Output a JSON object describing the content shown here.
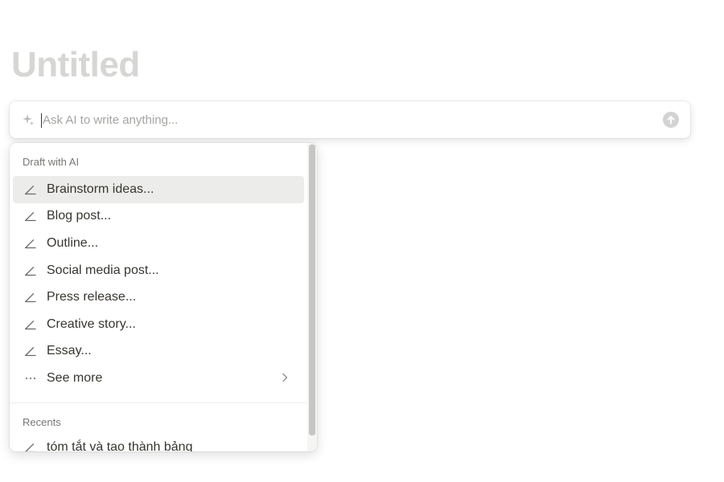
{
  "page": {
    "title": "Untitled"
  },
  "ai_prompt": {
    "placeholder": "Ask AI to write anything...",
    "value": "",
    "sparkle_icon": "sparkle-icon",
    "submit_icon": "arrow-up-circle-icon"
  },
  "menu": {
    "draft_section_label": "Draft with AI",
    "draft_items": [
      {
        "label": "Brainstorm ideas...",
        "icon": "pencil-icon",
        "selected": true
      },
      {
        "label": "Blog post...",
        "icon": "pencil-icon"
      },
      {
        "label": "Outline...",
        "icon": "pencil-icon"
      },
      {
        "label": "Social media post...",
        "icon": "pencil-icon"
      },
      {
        "label": "Press release...",
        "icon": "pencil-icon"
      },
      {
        "label": "Creative story...",
        "icon": "pencil-icon"
      },
      {
        "label": "Essay...",
        "icon": "pencil-icon"
      }
    ],
    "see_more": {
      "label": "See more",
      "icon": "ellipsis-icon",
      "trailing_icon": "chevron-right-icon"
    },
    "recents_section_label": "Recents",
    "recent_items": [
      {
        "label": "tóm tắt và tạo thành bảng",
        "icon": "pencil-icon"
      }
    ]
  },
  "colors": {
    "title": "#d6d6d4",
    "text": "#37352f",
    "placeholder": "#a5a4a0",
    "section_label": "#787774",
    "selected_bg": "#ececea"
  }
}
